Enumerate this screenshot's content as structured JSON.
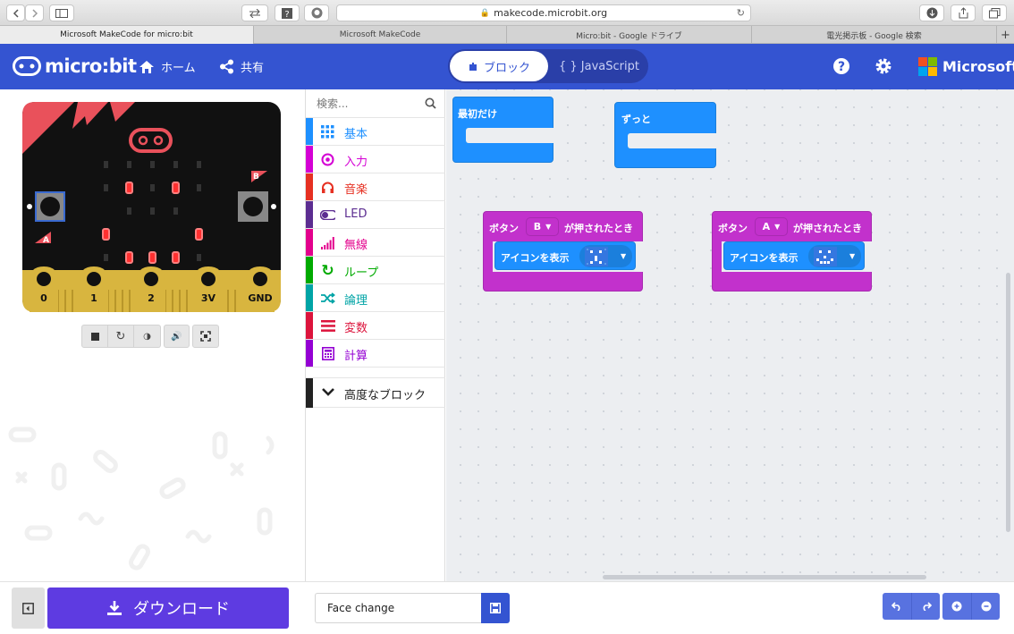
{
  "browser": {
    "url": "makecode.microbit.org",
    "tabs": [
      "Microsoft MakeCode for micro:bit",
      "Microsoft MakeCode",
      "Micro:bit - Google ドライブ",
      "電光掲示板 - Google 検索"
    ]
  },
  "header": {
    "logo": "micro:bit",
    "home": "ホーム",
    "share": "共有",
    "blocks_tab": "ブロック",
    "js_tab": "{ } JavaScript",
    "brand": "Microsoft"
  },
  "simulator": {
    "pins": [
      "0",
      "1",
      "2",
      "3V",
      "GND"
    ],
    "button_a": "A",
    "button_b": "B",
    "led_on": [
      [
        0,
        1,
        0,
        1,
        0
      ],
      [
        1,
        0,
        0,
        0,
        1
      ],
      [
        0,
        1,
        1,
        1,
        0
      ]
    ]
  },
  "toolbox": {
    "search_placeholder": "検索...",
    "categories": [
      {
        "label": "基本",
        "color": "#1e90ff"
      },
      {
        "label": "入力",
        "color": "#d400d4"
      },
      {
        "label": "音楽",
        "color": "#e63022"
      },
      {
        "label": "LED",
        "color": "#5c2d91"
      },
      {
        "label": "無線",
        "color": "#e3008c"
      },
      {
        "label": "ループ",
        "color": "#00aa00"
      },
      {
        "label": "論理",
        "color": "#00a4a6"
      },
      {
        "label": "変数",
        "color": "#dc143c"
      },
      {
        "label": "計算",
        "color": "#9400d3"
      }
    ],
    "advanced": "高度なブロック"
  },
  "workspace": {
    "on_start": "最初だけ",
    "forever": "ずっと",
    "button_event_prefix": "ボタン",
    "button_event_suffix": "が押されたとき",
    "show_icon": "アイコンを表示",
    "button_b": "B",
    "button_a": "A"
  },
  "footer": {
    "download": "ダウンロード",
    "project_name": "Face change"
  },
  "colors": {
    "header": "#3454d1",
    "basic_block": "#1e90ff",
    "input_block": "#d400d4",
    "download": "#5e3be1"
  }
}
